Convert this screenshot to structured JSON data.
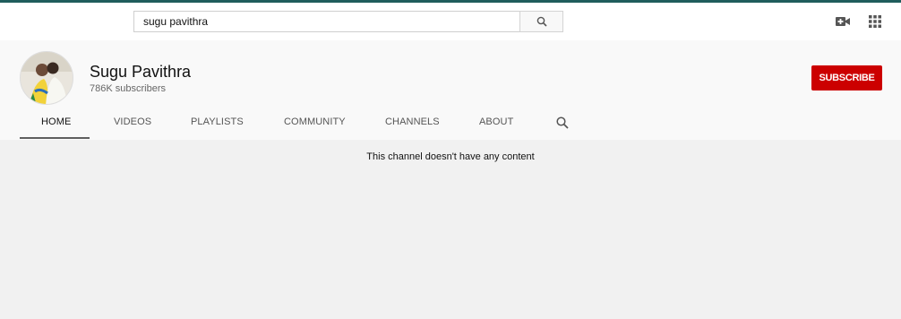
{
  "search": {
    "value": "sugu pavithra"
  },
  "channel": {
    "name": "Sugu Pavithra",
    "subscribers": "786K subscribers",
    "subscribe_label": "SUBSCRIBE"
  },
  "tabs": [
    {
      "label": "HOME",
      "active": true
    },
    {
      "label": "VIDEOS"
    },
    {
      "label": "PLAYLISTS"
    },
    {
      "label": "COMMUNITY"
    },
    {
      "label": "CHANNELS"
    },
    {
      "label": "ABOUT"
    }
  ],
  "icons": {
    "search_button": "search-icon",
    "create": "video-camera-icon",
    "apps": "apps-grid-icon",
    "channel_search": "search-icon"
  },
  "content": {
    "empty_message": "This channel doesn't have any content"
  },
  "colors": {
    "accent_bar": "#1f5d5c",
    "subscribe": "#cc0000"
  }
}
